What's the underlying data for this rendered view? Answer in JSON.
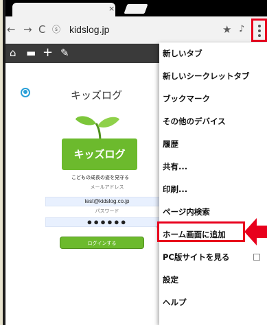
{
  "browser": {
    "url": "kidslog.jp",
    "tab_close": "×"
  },
  "page": {
    "title": "キッズログ",
    "logo_text": "キッズログ",
    "logo_tagline": "こどもの成長の姿を見守る",
    "email_label": "メールアドレス",
    "email_value": "test@kidslog.co.jp",
    "password_label": "パスワード",
    "password_value": "●●●●●●",
    "login_button": "ログインする"
  },
  "menu": {
    "items": [
      {
        "label": "新しいタブ"
      },
      {
        "label": "新しいシークレットタブ"
      },
      {
        "label": "ブックマーク"
      },
      {
        "label": "その他のデバイス"
      },
      {
        "label": "履歴"
      },
      {
        "label": "共有..."
      },
      {
        "label": "印刷..."
      },
      {
        "label": "ページ内検索"
      },
      {
        "label": "ホーム画面に追加"
      },
      {
        "label": "PC版サイトを見る"
      },
      {
        "label": "設定"
      },
      {
        "label": "ヘルプ"
      }
    ],
    "highlighted_item": "ホーム画面に追加"
  },
  "colors": {
    "accent_red": "#e8001c",
    "brand_green": "#6cba2d",
    "site_bar": "#3a3a3a",
    "user_icon": "#2aa0d8"
  },
  "icons": {
    "back": "back-arrow-icon",
    "forward": "forward-arrow-icon",
    "reload": "reload-icon",
    "site_info": "site-info-icon",
    "star": "bookmark-star-icon",
    "mic": "microphone-icon",
    "menu": "overflow-menu-icon"
  }
}
